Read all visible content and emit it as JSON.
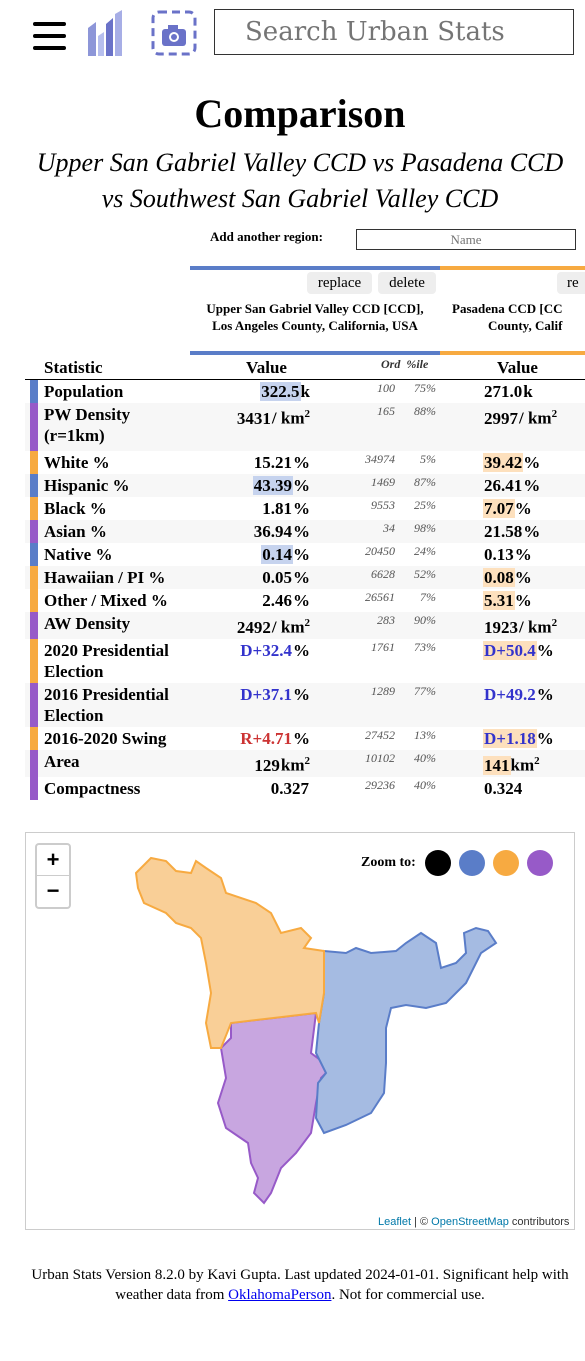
{
  "search": {
    "placeholder": "Search Urban Stats"
  },
  "title": "Comparison",
  "subtitle": "Upper San Gabriel Valley CCD vs Pasadena CCD vs Southwest San Gabriel Valley CCD",
  "add_region": {
    "label": "Add another region:",
    "placeholder": "Name"
  },
  "colors": {
    "blue": "#5a7dc8",
    "orange": "#f7aa41",
    "purple": "#975ac8",
    "highlight_blue": "#c6d3ee",
    "highlight_orange": "#fde0bd"
  },
  "regions": [
    {
      "replace": "replace",
      "delete": "delete",
      "name_line1": "Upper San Gabriel Valley CCD [CCD],",
      "name_line2": "Los Angeles County, California, USA"
    },
    {
      "replace": "re",
      "name_line1": "Pasadena CCD [CC",
      "name_line2": "County, Calif"
    }
  ],
  "table": {
    "headers": {
      "statistic": "Statistic",
      "value": "Value",
      "ord": "Ord",
      "pctile": "%ile",
      "value2": "Value"
    },
    "rows": [
      {
        "stat": "Population",
        "v1": "322.5",
        "u1": "k",
        "ord": "100",
        "pct": "75%",
        "v2": "271.0",
        "u2": "k",
        "color": "blue",
        "hl1": "blue"
      },
      {
        "stat": "PW Density",
        "stat2": "(r=1km)",
        "v1": "3431",
        "u1": "/ km",
        "ord": "165",
        "pct": "88%",
        "v2": "2997",
        "u2": "/ km",
        "color": "purple"
      },
      {
        "stat": "White %",
        "v1": "15.21",
        "u1": "%",
        "ord": "34974",
        "pct": "5%",
        "v2": "39.42",
        "u2": "%",
        "color": "orange",
        "hl2": "orange"
      },
      {
        "stat": "Hispanic %",
        "v1": "43.39",
        "u1": "%",
        "ord": "1469",
        "pct": "87%",
        "v2": "26.41",
        "u2": "%",
        "color": "blue",
        "hl1": "blue"
      },
      {
        "stat": "Black %",
        "v1": "1.81",
        "u1": "%",
        "ord": "9553",
        "pct": "25%",
        "v2": "7.07",
        "u2": "%",
        "color": "orange",
        "hl2": "orange"
      },
      {
        "stat": "Asian %",
        "v1": "36.94",
        "u1": "%",
        "ord": "34",
        "pct": "98%",
        "v2": "21.58",
        "u2": "%",
        "color": "purple"
      },
      {
        "stat": "Native %",
        "v1": "0.14",
        "u1": "%",
        "ord": "20450",
        "pct": "24%",
        "v2": "0.13",
        "u2": "%",
        "color": "blue",
        "hl1": "blue"
      },
      {
        "stat": "Hawaiian / PI %",
        "v1": "0.05",
        "u1": "%",
        "ord": "6628",
        "pct": "52%",
        "v2": "0.08",
        "u2": "%",
        "color": "orange",
        "hl2": "orange"
      },
      {
        "stat": "Other / Mixed %",
        "v1": "2.46",
        "u1": "%",
        "ord": "26561",
        "pct": "7%",
        "v2": "5.31",
        "u2": "%",
        "color": "orange",
        "hl2": "orange"
      },
      {
        "stat": "AW Density",
        "v1": "2492",
        "u1": "/ km",
        "ord": "283",
        "pct": "90%",
        "v2": "1923",
        "u2": "/ km",
        "color": "purple"
      },
      {
        "stat": "2020 Presidential",
        "stat2": "Election",
        "v1": "D+32.4",
        "u1": "%",
        "ord": "1761",
        "pct": "73%",
        "v2": "D+50.4",
        "u2": "%",
        "color": "orange",
        "hl2": "orange",
        "party1": "D",
        "party2": "D"
      },
      {
        "stat": "2016 Presidential",
        "stat2": "Election",
        "v1": "D+37.1",
        "u1": "%",
        "ord": "1289",
        "pct": "77%",
        "v2": "D+49.2",
        "u2": "%",
        "color": "purple",
        "party1": "D",
        "party2": "D"
      },
      {
        "stat": "2016-2020 Swing",
        "v1": "R+4.71",
        "u1": "%",
        "ord": "27452",
        "pct": "13%",
        "v2": "D+1.18",
        "u2": "%",
        "color": "orange",
        "hl2": "orange",
        "party1": "R",
        "party2": "D"
      },
      {
        "stat": "Area",
        "v1": "129",
        "u1": "km",
        "ord": "10102",
        "pct": "40%",
        "v2": "141",
        "u2": "km",
        "color": "purple",
        "hl2": "orange"
      },
      {
        "stat": "Compactness",
        "v1": "0.327",
        "u1": "",
        "ord": "29236",
        "pct": "40%",
        "v2": "0.324",
        "u2": "",
        "color": "purple"
      }
    ]
  },
  "map": {
    "zoom_in": "+",
    "zoom_out": "−",
    "zoom_to": "Zoom to:",
    "zoom_colors": [
      "#000000",
      "#5a7dc8",
      "#f7aa41",
      "#975ac8"
    ],
    "attrib_leaflet": "Leaflet",
    "attrib_sep": " | © ",
    "attrib_osm": "OpenStreetMap",
    "attrib_tail": " contributors"
  },
  "footer": {
    "text1": "Urban Stats Version 8.2.0 by Kavi Gupta. Last updated 2024-01-01. Significant help with weather data from ",
    "link": "OklahomaPerson",
    "text2": ". Not for commercial use."
  }
}
